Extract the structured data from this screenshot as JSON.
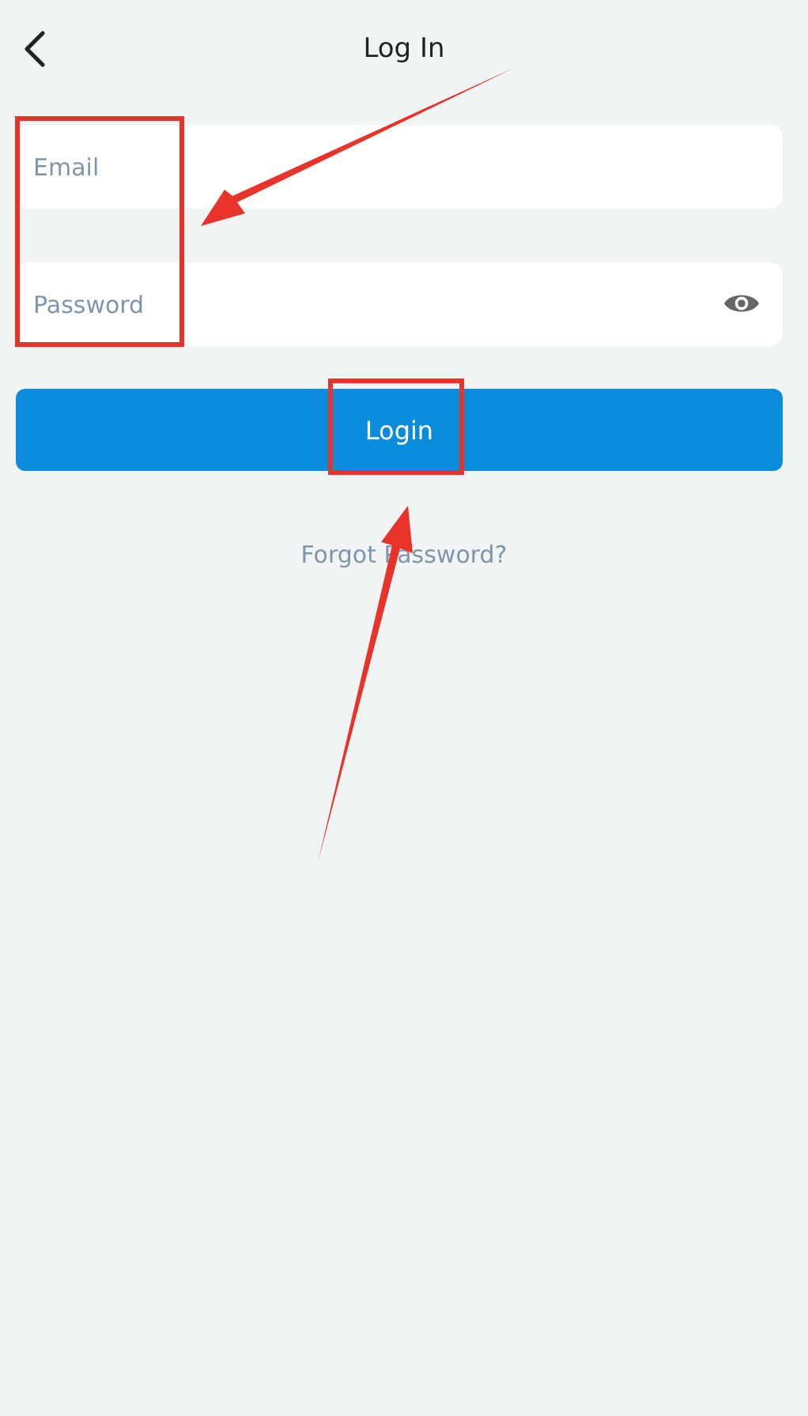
{
  "header": {
    "title": "Log In"
  },
  "fields": [
    {
      "kind": "email",
      "placeholder": "Email"
    },
    {
      "kind": "password",
      "placeholder": "Password"
    }
  ],
  "login_button": {
    "label": "Login"
  },
  "forgot_link": {
    "label": "Forgot Password?"
  }
}
